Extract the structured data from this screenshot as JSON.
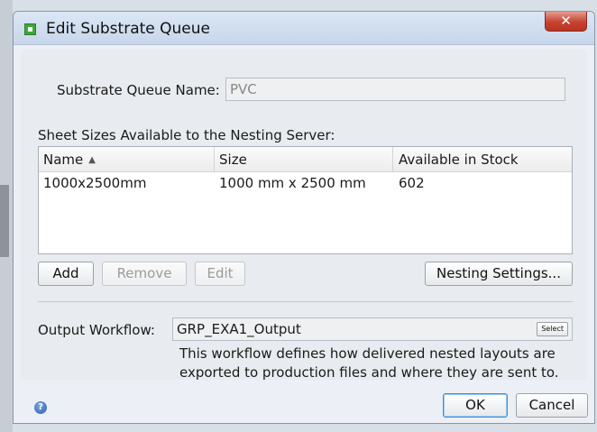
{
  "window": {
    "title": "Edit Substrate Queue",
    "close_glyph": "✕"
  },
  "queue_name": {
    "label": "Substrate Queue Name:",
    "value": "PVC"
  },
  "sheets": {
    "label": "Sheet Sizes Available to the Nesting Server:",
    "columns": [
      "Name",
      "Size",
      "Available in Stock"
    ],
    "sort_indicator": "▲",
    "rows": [
      [
        "1000x2500mm",
        "1000 mm x 2500 mm",
        "602"
      ]
    ]
  },
  "buttons": {
    "add": "Add",
    "remove": "Remove",
    "edit": "Edit",
    "nesting_settings": "Nesting Settings..."
  },
  "output_workflow": {
    "label": "Output Workflow:",
    "value": "GRP_EXA1_Output",
    "select_label": "Select",
    "description": "This workflow defines how delivered nested layouts are exported to production files and where they are sent to."
  },
  "footer": {
    "help_glyph": "?",
    "ok": "OK",
    "cancel": "Cancel"
  },
  "colors": {
    "ok_border": "#3b8fd6",
    "close_red": "#c6432f",
    "app_icon_green": "#3ca83a"
  }
}
